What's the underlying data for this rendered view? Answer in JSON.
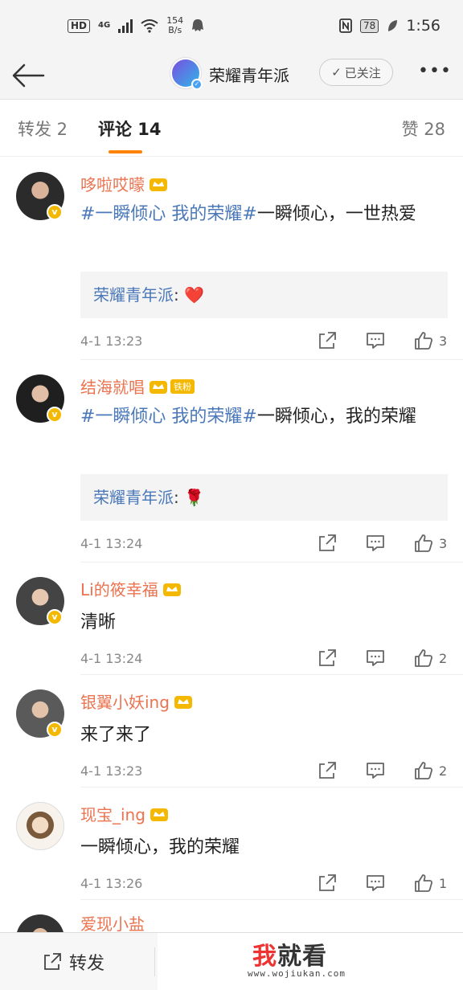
{
  "status_bar": {
    "network_hd": "HD",
    "network_type": "4G",
    "speed_value": "154",
    "speed_unit": "B/s",
    "battery": "78",
    "time": "1:56"
  },
  "nav": {
    "title": "荣耀青年派",
    "follow_label": "已关注"
  },
  "tabs": {
    "repost": "转发 2",
    "comment": "评论 14",
    "like": "赞 28"
  },
  "comments": [
    {
      "user": "哆啦哎曚",
      "topic": "#一瞬倾心 我的荣耀#",
      "text": "一瞬倾心，一世热爱",
      "reply_user": "荣耀青年派",
      "reply_text": "❤️",
      "time": "4-1 13:23",
      "likes": "3",
      "avatar_color": "#3a3a3a"
    },
    {
      "user": "结海就唱",
      "fan_badge": "铁粉",
      "topic": "#一瞬倾心 我的荣耀#",
      "text": "一瞬倾心，我的荣耀",
      "reply_user": "荣耀青年派",
      "reply_text": "🌹",
      "time": "4-1 13:24",
      "likes": "3",
      "avatar_color": "#2d2d2d"
    },
    {
      "user": "Li的筱幸福",
      "text": "清晰",
      "time": "4-1 13:24",
      "likes": "2",
      "avatar_color": "#444444"
    },
    {
      "user": "银翼小妖ing",
      "text": "来了来了",
      "time": "4-1 13:23",
      "likes": "2",
      "avatar_color": "#555555"
    },
    {
      "user": "现宝_ing",
      "text": "一瞬倾心，我的荣耀",
      "time": "4-1 13:26",
      "likes": "1",
      "avatar_color": "#e7c9a8"
    },
    {
      "user": "爱现小盐",
      "avatar_color": "#3a3a3a"
    }
  ],
  "bottom_bar": {
    "repost_label": "转发",
    "watermark_brand_accent": "我",
    "watermark_brand_rest": "就看",
    "watermark_url": "www.wojiukan.com"
  },
  "colors": {
    "username": "#eb7350",
    "topic_link": "#4a78b8",
    "tab_indicator": "#ff8200",
    "verified_badge": "#f5b800"
  }
}
